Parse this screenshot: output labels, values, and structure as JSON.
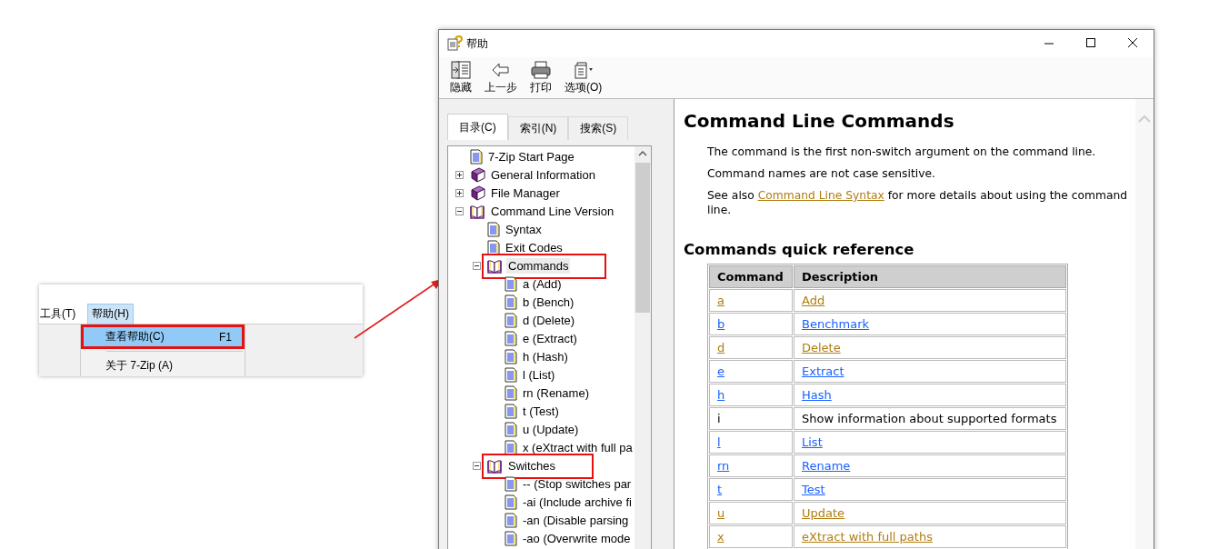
{
  "menu_snippet": {
    "menubar": [
      {
        "label": "工具(T)",
        "selected": false
      },
      {
        "label": "帮助(H)",
        "selected": true
      }
    ],
    "items": [
      {
        "label": "查看帮助(C)",
        "shortcut": "F1",
        "selected": true,
        "annotated": true
      },
      {
        "label": "关于 7-Zip (A)",
        "selected": false,
        "annotated": false
      }
    ]
  },
  "window": {
    "title": "帮助"
  },
  "toolbar": [
    {
      "kind": "hide",
      "label": "隐藏"
    },
    {
      "kind": "back",
      "label": "上一步"
    },
    {
      "kind": "print",
      "label": "打印"
    },
    {
      "kind": "options",
      "label": "选项(O)"
    }
  ],
  "tabs": [
    {
      "label": "目录(C)",
      "selected": true
    },
    {
      "label": "索引(N)",
      "selected": false
    },
    {
      "label": "搜索(S)",
      "selected": false
    }
  ],
  "tree": [
    {
      "label": "7-Zip Start Page",
      "kind": "doc",
      "selected": false,
      "annotated": false
    },
    {
      "label": "General Information",
      "kind": "book",
      "expanded": false,
      "selected": false,
      "annotated": false
    },
    {
      "label": "File Manager",
      "kind": "book",
      "expanded": false,
      "selected": false,
      "annotated": false
    },
    {
      "label": "Command Line Version",
      "kind": "book",
      "expanded": true,
      "selected": false,
      "annotated": false,
      "children": [
        {
          "label": "Syntax",
          "kind": "doc",
          "selected": false,
          "annotated": false
        },
        {
          "label": "Exit Codes",
          "kind": "doc",
          "selected": false,
          "annotated": false
        },
        {
          "label": "Commands",
          "kind": "book",
          "expanded": true,
          "selected": true,
          "annotated": true,
          "children": [
            {
              "label": "a (Add)",
              "kind": "doc",
              "selected": false,
              "annotated": false
            },
            {
              "label": "b (Bench)",
              "kind": "doc",
              "selected": false,
              "annotated": false
            },
            {
              "label": "d (Delete)",
              "kind": "doc",
              "selected": false,
              "annotated": false
            },
            {
              "label": "e (Extract)",
              "kind": "doc",
              "selected": false,
              "annotated": false
            },
            {
              "label": "h (Hash)",
              "kind": "doc",
              "selected": false,
              "annotated": false
            },
            {
              "label": "l (List)",
              "kind": "doc",
              "selected": false,
              "annotated": false
            },
            {
              "label": "rn (Rename)",
              "kind": "doc",
              "selected": false,
              "annotated": false
            },
            {
              "label": "t (Test)",
              "kind": "doc",
              "selected": false,
              "annotated": false
            },
            {
              "label": "u (Update)",
              "kind": "doc",
              "selected": false,
              "annotated": false
            },
            {
              "label": "x (eXtract with full pa",
              "kind": "doc",
              "selected": false,
              "annotated": false
            }
          ]
        },
        {
          "label": "Switches",
          "kind": "book",
          "expanded": true,
          "selected": false,
          "annotated": true,
          "children": [
            {
              "label": "-- (Stop switches par",
              "kind": "doc",
              "selected": false,
              "annotated": false
            },
            {
              "label": "-ai (Include archive fi",
              "kind": "doc",
              "selected": false,
              "annotated": false
            },
            {
              "label": "-an (Disable parsing",
              "kind": "doc",
              "selected": false,
              "annotated": false
            },
            {
              "label": "-ao (Overwrite mode",
              "kind": "doc",
              "selected": false,
              "annotated": false
            }
          ]
        }
      ]
    }
  ],
  "content": {
    "title": "Command Line Commands",
    "paragraphs": [
      {
        "text": "The command is the first non-switch argument on the command line."
      },
      {
        "text": "Command names are not case sensitive."
      },
      {
        "text": "See also ",
        "link": "Command Line Syntax",
        "link_visited": true,
        "after": " for more details about using the command line."
      }
    ],
    "section_title": "Commands quick reference",
    "table": {
      "columns": [
        "Command",
        "Description"
      ],
      "rows": [
        {
          "kind": "link",
          "command": "a",
          "description": "Add",
          "visited": true
        },
        {
          "kind": "link",
          "command": "b",
          "description": "Benchmark",
          "visited": false
        },
        {
          "kind": "link",
          "command": "d",
          "description": "Delete",
          "visited": true
        },
        {
          "kind": "link",
          "command": "e",
          "description": "Extract",
          "visited": false
        },
        {
          "kind": "link",
          "command": "h",
          "description": "Hash",
          "visited": false
        },
        {
          "kind": "text",
          "command": "i",
          "description": "Show information about supported formats"
        },
        {
          "kind": "link",
          "command": "l",
          "description": "List",
          "visited": false
        },
        {
          "kind": "link",
          "command": "rn",
          "description": "Rename",
          "visited": false
        },
        {
          "kind": "link",
          "command": "t",
          "description": "Test",
          "visited": false
        },
        {
          "kind": "link",
          "command": "u",
          "description": "Update",
          "visited": true
        },
        {
          "kind": "link",
          "command": "x",
          "description": "eXtract with full paths",
          "visited": true
        }
      ]
    }
  }
}
